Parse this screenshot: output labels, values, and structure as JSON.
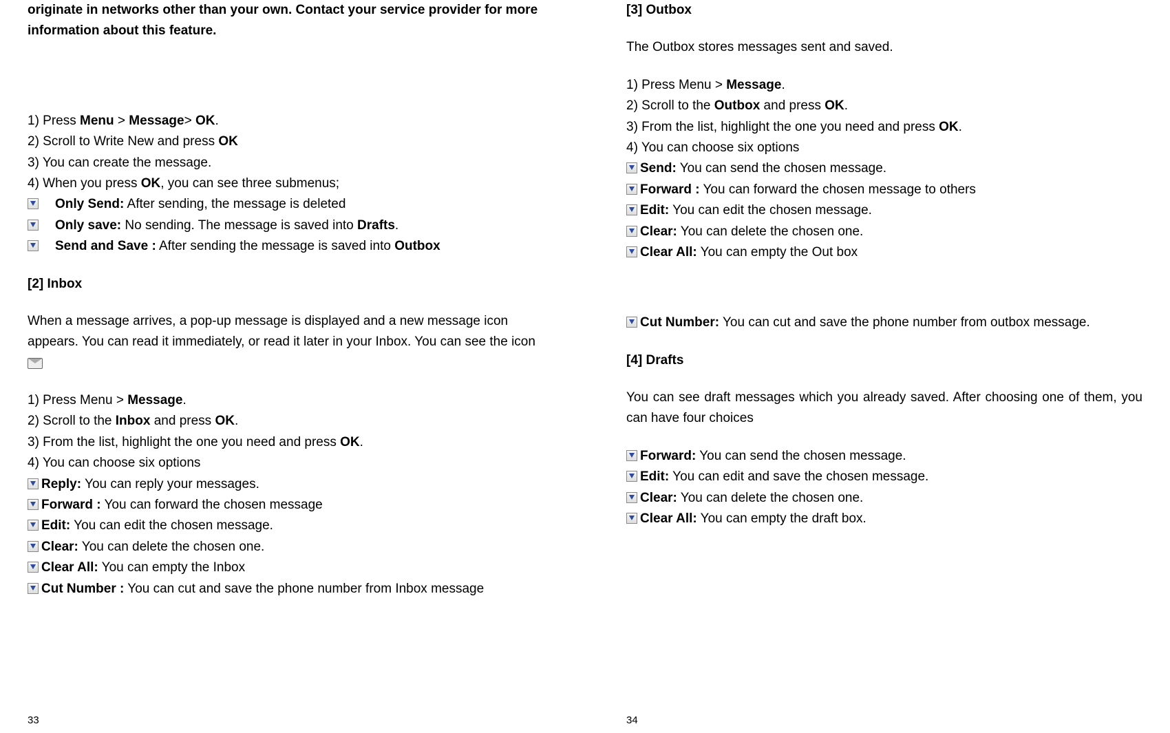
{
  "left": {
    "intro": "originate in networks other than your own. Contact your service provider for more information about this feature.",
    "write": {
      "s1_a": "1) Press ",
      "s1_b": "Menu",
      "s1_c": " > ",
      "s1_d": "Message",
      "s1_e": "> ",
      "s1_f": "OK",
      "s1_g": ".",
      "s2_a": "2) Scroll to Write New and press ",
      "s2_b": "OK",
      "s3": "3) You can create the message.",
      "s4_a": "4) When you press ",
      "s4_b": "OK",
      "s4_c": ", you can see three submenus;",
      "b1_a": "Only Send:",
      "b1_b": " After sending, the message is deleted",
      "b2_a": "Only save:",
      "b2_b": " No sending. The message is saved into ",
      "b2_c": "Drafts",
      "b2_d": ".",
      "b3_a": "Send and Save :",
      "b3_b": " After sending the message is saved into ",
      "b3_c": "Outbox"
    },
    "inbox": {
      "head": "[2]    Inbox",
      "intro_a": "When a message arrives, a pop-up message is displayed and a new message icon appears. You can read it immediately, or read it later in your Inbox. You can see the icon ",
      "s1_a": "1)  Press Menu > ",
      "s1_b": "Message",
      "s1_c": ".",
      "s2_a": "2)  Scroll to the ",
      "s2_b": "Inbox",
      "s2_c": " and press ",
      "s2_d": "OK",
      "s2_e": ".",
      "s3_a": "3)  From the list, highlight the one you need and press ",
      "s3_b": "OK",
      "s3_c": ".",
      "s4": "4)  You can choose six options",
      "o1_a": "Reply:",
      "o1_b": " You can reply your messages.",
      "o2_a": "Forward :",
      "o2_b": " You can forward the chosen message",
      "o3_a": "Edit:",
      "o3_b": " You can edit the chosen message.",
      "o4_a": "Clear:",
      "o4_b": " You can delete the chosen one.",
      "o5_a": "Clear All:",
      "o5_b": " You can empty the Inbox",
      "o6_a": "Cut Number :",
      "o6_b": " You can cut and save the phone number from Inbox message"
    },
    "pagenum": "33"
  },
  "right": {
    "outbox": {
      "head": "[3]    Outbox",
      "intro": "The Outbox stores messages sent and saved.",
      "s1_a": "1)  Press Menu > ",
      "s1_b": "Message",
      "s1_c": ".",
      "s2_a": "2)  Scroll to the ",
      "s2_b": "Outbox",
      "s2_c": " and press ",
      "s2_d": "OK",
      "s2_e": ".",
      "s3_a": "3)  From the list, highlight the one you need and press ",
      "s3_b": "OK",
      "s3_c": ".",
      "s4": "4)  You can choose six options",
      "o1_a": "Send:",
      "o1_b": " You can send the chosen message.",
      "o2_a": "Forward :",
      "o2_b": " You can forward the chosen message to others",
      "o3_a": "Edit:",
      "o3_b": " You can edit the chosen message.",
      "o4_a": "Clear:",
      "o4_b": " You can delete the chosen one.",
      "o5_a": "Clear All:",
      "o5_b": " You can empty the Out box",
      "o6_a": "Cut Number:",
      "o6_b": " You can cut and save the phone number from outbox message."
    },
    "drafts": {
      "head": "[4]  Drafts",
      "intro": "You can see draft messages which you already saved. After choosing one of them, you can have four choices",
      "o1_a": "Forward:",
      "o1_b": " You can send the chosen message.",
      "o2_a": "Edit:",
      "o2_b": " You can edit and save the chosen message.",
      "o3_a": "Clear:",
      "o3_b": " You can delete the chosen one.",
      "o4_a": "Clear All:",
      "o4_b": " You can empty the draft box."
    },
    "pagenum": "34"
  }
}
